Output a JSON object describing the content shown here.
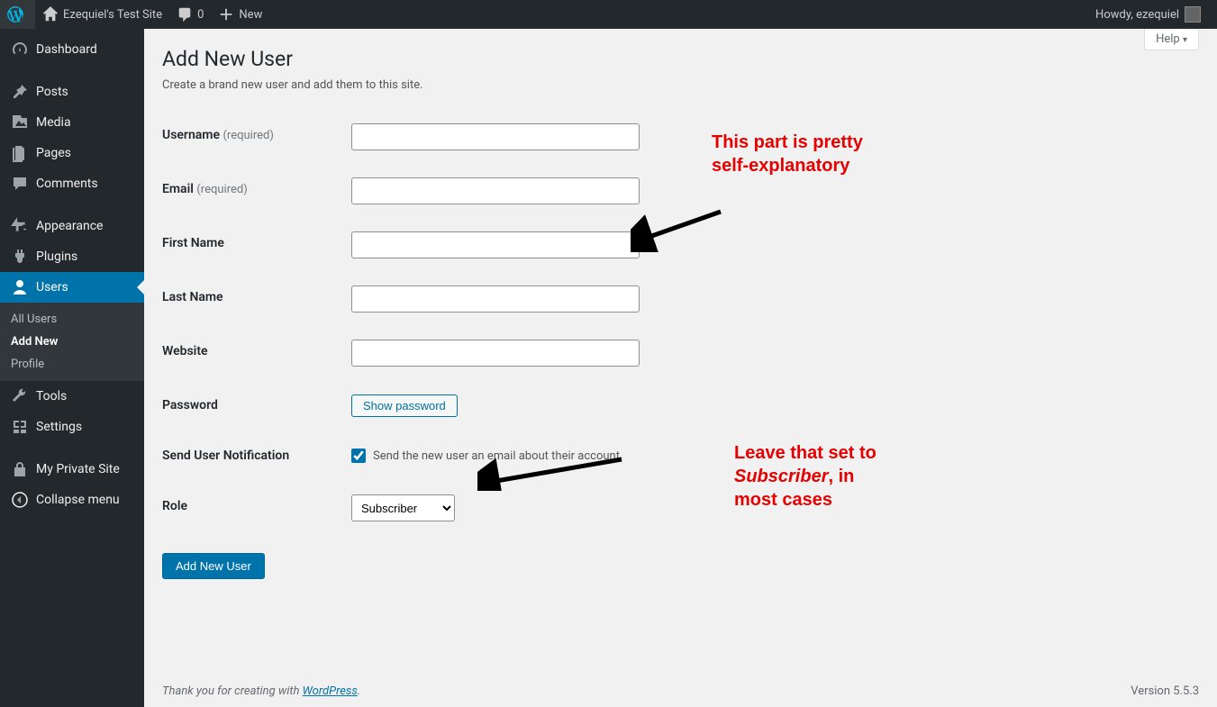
{
  "adminbar": {
    "site_name": "Ezequiel's Test Site",
    "comments_count": "0",
    "new_label": "New",
    "howdy": "Howdy, ezequiel"
  },
  "sidebar": {
    "items": [
      {
        "label": "Dashboard"
      },
      {
        "label": "Posts"
      },
      {
        "label": "Media"
      },
      {
        "label": "Pages"
      },
      {
        "label": "Comments"
      },
      {
        "label": "Appearance"
      },
      {
        "label": "Plugins"
      },
      {
        "label": "Users"
      },
      {
        "label": "Tools"
      },
      {
        "label": "Settings"
      },
      {
        "label": "My Private Site"
      },
      {
        "label": "Collapse menu"
      }
    ],
    "users_submenu": [
      {
        "label": "All Users"
      },
      {
        "label": "Add New"
      },
      {
        "label": "Profile"
      }
    ]
  },
  "help": {
    "label": "Help"
  },
  "page": {
    "title": "Add New User",
    "description": "Create a brand new user and add them to this site."
  },
  "form": {
    "username_label": "Username",
    "username_req": "(required)",
    "email_label": "Email",
    "email_req": "(required)",
    "firstname_label": "First Name",
    "lastname_label": "Last Name",
    "website_label": "Website",
    "password_label": "Password",
    "show_password_btn": "Show password",
    "notification_label": "Send User Notification",
    "notification_text": "Send the new user an email about their account.",
    "role_label": "Role",
    "role_value": "Subscriber",
    "submit_label": "Add New User"
  },
  "footer": {
    "thank_you_pre": "Thank you for creating with ",
    "thank_you_link": "WordPress",
    "thank_you_post": ".",
    "version": "Version 5.5.3"
  },
  "annotations": {
    "top_line1": "This part is pretty",
    "top_line2": "self-explanatory",
    "bottom_line1": "Leave that set to",
    "bottom_line2_italic": "Subscriber",
    "bottom_line2_rest": ", in",
    "bottom_line3": "most cases"
  }
}
